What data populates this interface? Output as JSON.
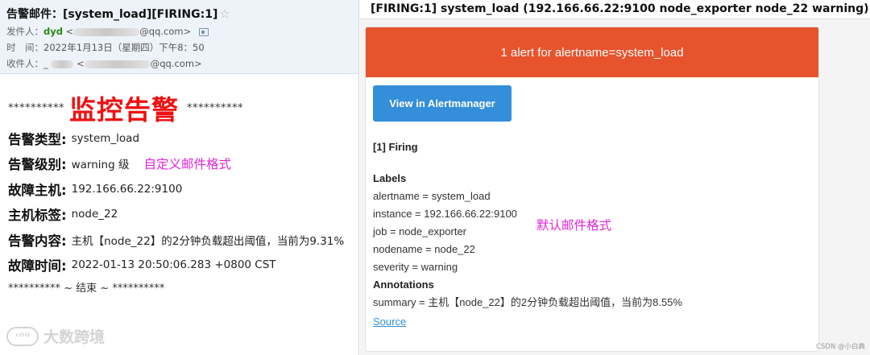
{
  "left": {
    "subject": "告警邮件：[system_load][FIRING:1]",
    "subject_star": "☆",
    "from_label": "发件人：",
    "from_name": "dyd",
    "from_addr_prefix": "<",
    "from_addr_suffix": "@qq.com>",
    "time_label": "时　间：",
    "time_value": "2022年1月13日（星期四）下午8：50",
    "to_label": "收件人：",
    "to_name": "_",
    "to_addr_prefix": "<",
    "to_addr_suffix": "@qq.com>",
    "banner_stars_left": "**********",
    "banner_title": "监控告警",
    "banner_stars_right": "**********",
    "fields": [
      {
        "key": "告警类型:",
        "value": "system_load"
      },
      {
        "key": "告警级别:",
        "value": "warning 级"
      },
      {
        "key": "故障主机:",
        "value": "192.166.66.22:9100"
      },
      {
        "key": "主机标签:",
        "value": "node_22"
      },
      {
        "key": "告警内容:",
        "value": "主机【node_22】的2分钟负载超出阈值，当前为9.31%"
      },
      {
        "key": "故障时间:",
        "value": "2022-01-13 20:50:06.283 +0800 CST"
      }
    ],
    "custom_note": "自定义邮件格式",
    "end_line": "********** ~ 结束 ~ **********",
    "watermark_logo": "ᶜᴼᴼ",
    "watermark_text": "大数跨境"
  },
  "right": {
    "title": "[FIRING:1] system_load (192.166.66.22:9100 node_exporter node_22 warning)",
    "header": "1 alert for alertname=system_load",
    "button": "View in Alertmanager",
    "firing": "[1] Firing",
    "labels_title": "Labels",
    "labels": [
      "alertname = system_load",
      "instance = 192.166.66.22:9100",
      "job = node_exporter",
      "nodename = node_22",
      "severity = warning"
    ],
    "annotations_title": "Annotations",
    "annotations": [
      "summary = 主机【node_22】的2分钟负载超出阈值，当前为8.55%"
    ],
    "source": "Source",
    "default_note": "默认邮件格式",
    "csdn": "CSDN @小白典"
  },
  "colors": {
    "alert_header": "#e6532d",
    "button": "#348eda",
    "banner_red": "#ee1111",
    "note_magenta": "#e424d8",
    "sender_green": "#2b8a14"
  }
}
